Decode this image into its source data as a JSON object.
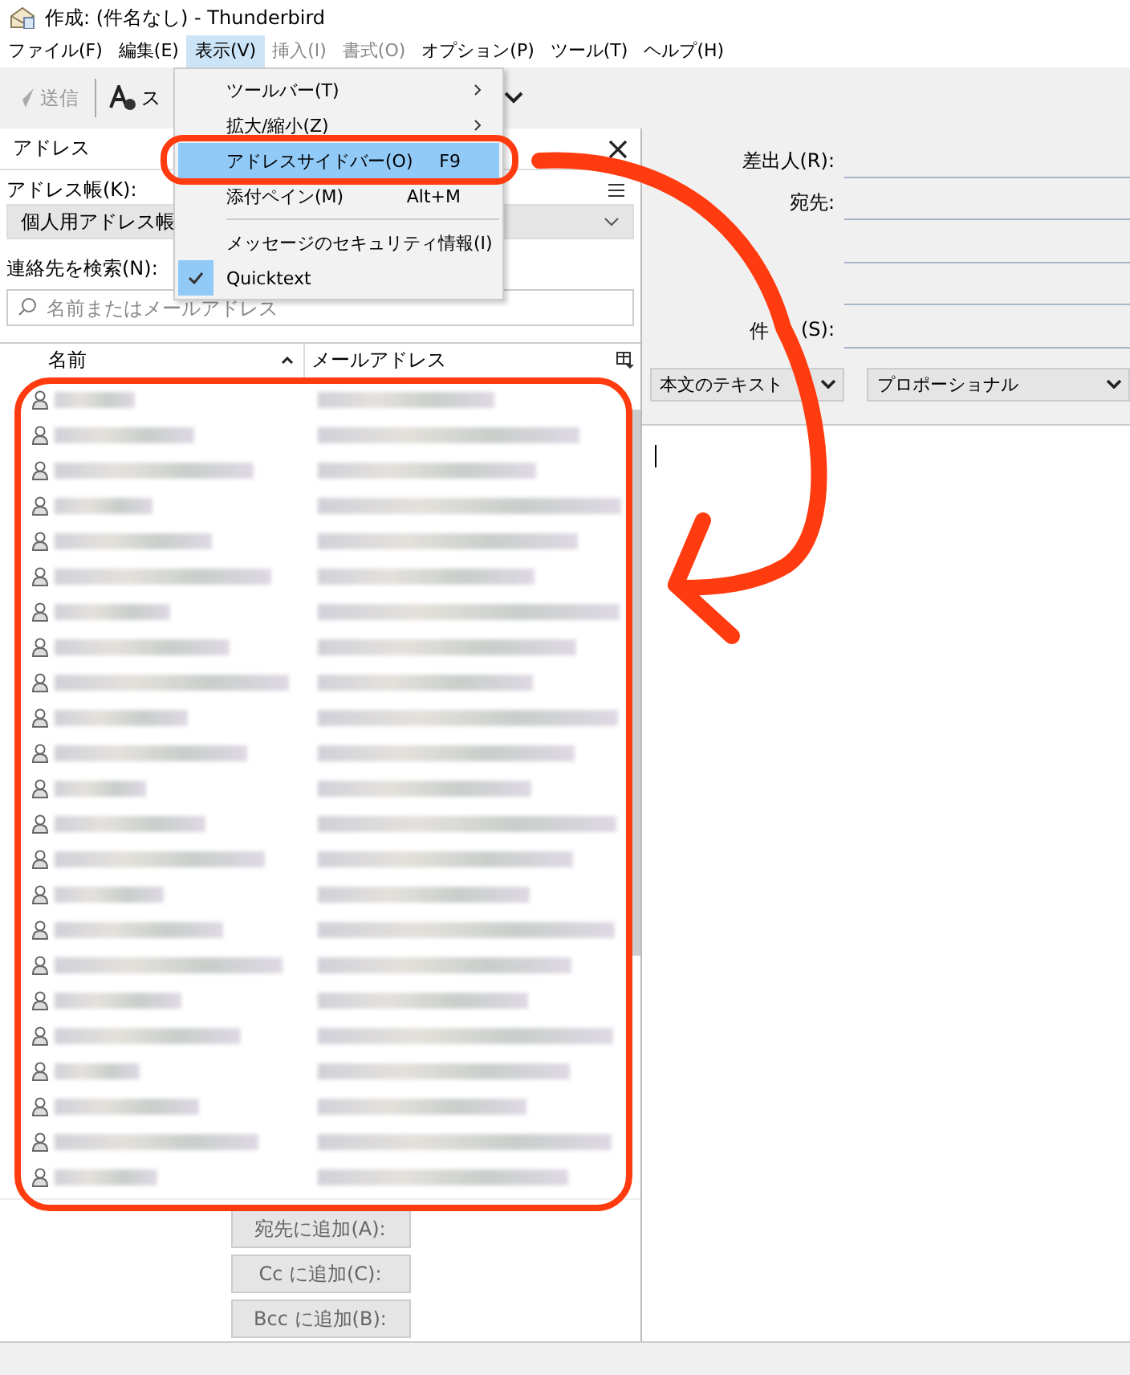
{
  "window": {
    "title": "作成: (件名なし) - Thunderbird"
  },
  "menubar": {
    "items": [
      {
        "label": "ファイル(F)",
        "selected": false,
        "disabled": false
      },
      {
        "label": "編集(E)",
        "selected": false,
        "disabled": false
      },
      {
        "label": "表示(V)",
        "selected": true,
        "disabled": false
      },
      {
        "label": "挿入(I)",
        "selected": false,
        "disabled": true
      },
      {
        "label": "書式(O)",
        "selected": false,
        "disabled": true
      },
      {
        "label": "オプション(P)",
        "selected": false,
        "disabled": false
      },
      {
        "label": "ツール(T)",
        "selected": false,
        "disabled": false
      },
      {
        "label": "ヘルプ(H)",
        "selected": false,
        "disabled": false
      }
    ]
  },
  "toolbar": {
    "send": {
      "label": "送信",
      "disabled": true
    },
    "spell": {
      "label": "ス"
    }
  },
  "view_menu": {
    "items": [
      {
        "kind": "item",
        "label": "ツールバー(T)",
        "submenu": true,
        "selected": false,
        "checked": false
      },
      {
        "kind": "item",
        "label": "拡大/縮小(Z)",
        "submenu": true,
        "selected": false,
        "checked": false
      },
      {
        "kind": "item",
        "label": "アドレスサイドバー(O)",
        "shortcut": "F9",
        "submenu": false,
        "selected": true,
        "checked": false
      },
      {
        "kind": "item",
        "label": "添付ペイン(M)",
        "shortcut": "Alt+M",
        "submenu": false,
        "selected": false,
        "checked": false
      },
      {
        "kind": "separator"
      },
      {
        "kind": "item",
        "label": "メッセージのセキュリティ情報(I)",
        "submenu": false,
        "selected": false,
        "checked": false
      },
      {
        "kind": "item",
        "label": "Quicktext",
        "submenu": false,
        "selected": false,
        "checked": true
      }
    ]
  },
  "sidebar": {
    "title": "アドレス",
    "addressbook_label": "アドレス帳(K):",
    "addressbook": "個人用アドレス帳",
    "search_label": "連絡先を検索(N):",
    "search": {
      "placeholder": "名前またはメールアドレス"
    },
    "columns": [
      "名前",
      "メールアドレス"
    ],
    "contacts": [
      {
        "kind": "contact"
      },
      {
        "kind": "contact"
      },
      {
        "kind": "contact"
      },
      {
        "kind": "contact"
      },
      {
        "kind": "contact"
      },
      {
        "kind": "contact"
      },
      {
        "kind": "contact"
      },
      {
        "kind": "contact"
      },
      {
        "kind": "contact"
      },
      {
        "kind": "contact"
      },
      {
        "kind": "contact"
      },
      {
        "kind": "contact"
      },
      {
        "kind": "contact"
      },
      {
        "kind": "contact"
      },
      {
        "kind": "contact"
      },
      {
        "kind": "contact"
      },
      {
        "kind": "contact"
      },
      {
        "kind": "contact"
      },
      {
        "kind": "contact"
      },
      {
        "kind": "contact"
      },
      {
        "kind": "contact"
      },
      {
        "kind": "contact"
      },
      {
        "kind": "contact"
      }
    ],
    "buttons": [
      "宛先に追加(A):",
      "Cc に追加(C):",
      "Bcc に追加(B):"
    ]
  },
  "compose": {
    "fields": [
      {
        "kind": "labeled",
        "label_parts": [
          "差出人(R):"
        ]
      },
      {
        "kind": "labeled",
        "label_parts": [
          "宛先:"
        ]
      },
      {
        "kind": "blank"
      },
      {
        "kind": "blank"
      },
      {
        "kind": "labeled",
        "label_parts": [
          "件",
          "(S):"
        ]
      }
    ],
    "format": "本文のテキスト",
    "font": "プロポーショナル"
  },
  "annotations": [
    {
      "kind": "outline"
    },
    {
      "kind": "outline"
    },
    {
      "kind": "arrow"
    }
  ]
}
